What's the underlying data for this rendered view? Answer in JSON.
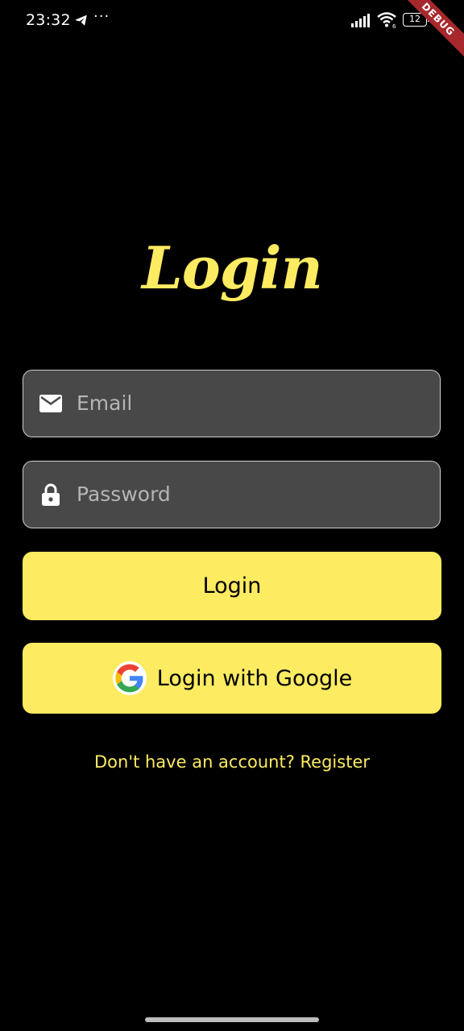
{
  "status_bar": {
    "time": "23:32",
    "more_dots": "···",
    "battery_level": "12",
    "debug_label": "DEBUG"
  },
  "login_screen": {
    "title": "Login",
    "email": {
      "placeholder": "Email",
      "value": "",
      "icon": "mail-icon"
    },
    "password": {
      "placeholder": "Password",
      "value": "",
      "icon": "lock-icon"
    },
    "login_button_label": "Login",
    "google_button_label": "Login with Google",
    "google_icon": "google-icon",
    "register_text": "Don't have an account? Register"
  },
  "colors": {
    "background": "#000000",
    "accent": "#fdeb61",
    "field_background": "#484848",
    "field_border": "#cfcfcf",
    "debug_banner": "#a7282c"
  }
}
